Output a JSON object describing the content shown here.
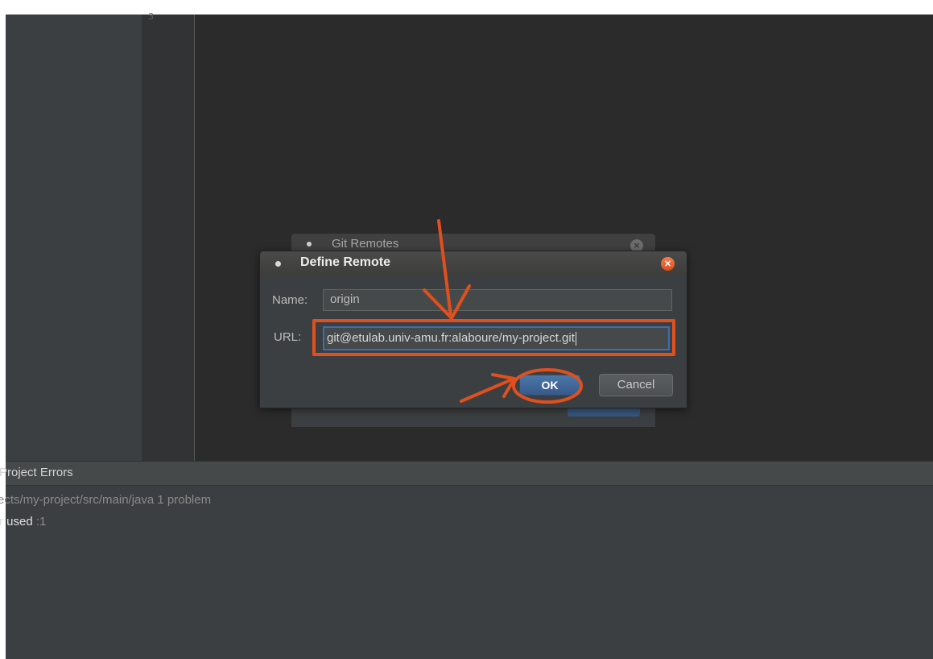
{
  "browser": {
    "top_strip_text": ""
  },
  "editor": {
    "line_number": "3"
  },
  "background_dialog": {
    "title": "Git Remotes",
    "close_glyph": "×"
  },
  "dialog": {
    "title": "Define Remote",
    "close_glyph": "×",
    "name_label": "Name:",
    "name_value": "origin",
    "url_label": "URL:",
    "url_value": "git@etulab.univ-amu.fr:alaboure/my-project.git",
    "ok_label": "OK",
    "cancel_label": "Cancel"
  },
  "bottom_panel": {
    "title": "Project Errors",
    "path_text": "ects/my-project/src/main/java  1 problem",
    "problem_message": "r used",
    "problem_location": " :1"
  },
  "colors": {
    "annotation": "#e0501e",
    "close_button": "#e8602c",
    "ok_button": "#3e6797",
    "url_focus_border": "#3d6fb0"
  }
}
